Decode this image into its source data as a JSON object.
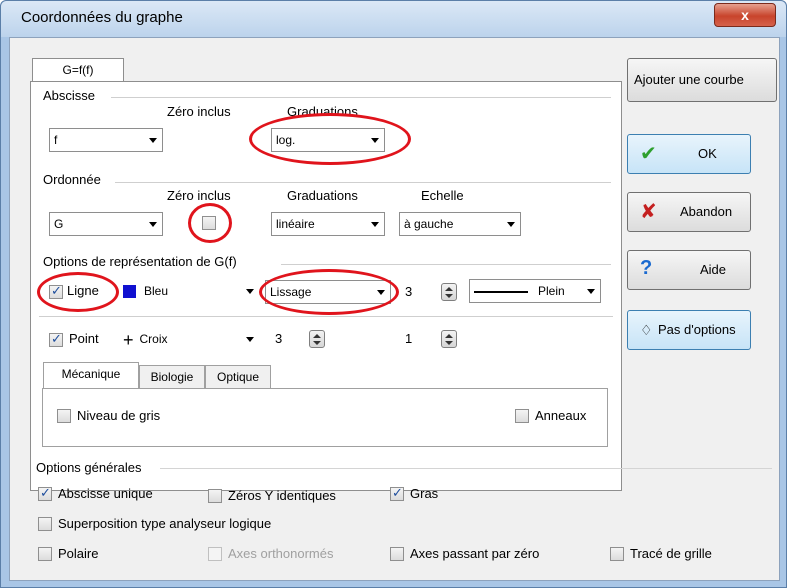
{
  "window": {
    "title": "Coordonnées du graphe",
    "close_label": "x"
  },
  "tab": {
    "label": "G=f(f)"
  },
  "abscisse": {
    "group_label": "Abscisse",
    "zero_label": "Zéro inclus",
    "grad_label": "Graduations",
    "variable": "f",
    "graduations": "log."
  },
  "ordonnee": {
    "group_label": "Ordonnée",
    "zero_label": "Zéro inclus",
    "grad_label": "Graduations",
    "echelle_label": "Echelle",
    "variable": "G",
    "zero_checked": false,
    "graduations": "linéaire",
    "echelle": "à gauche"
  },
  "representation": {
    "group_label": "Options de représentation de G(f)",
    "ligne_label": "Ligne",
    "ligne_checked": true,
    "color": "Bleu",
    "color_hex": "#1010d0",
    "lissage": "Lissage",
    "line_width": "3",
    "line_style": "Plein",
    "point_label": "Point",
    "point_checked": true,
    "point_type": "Croix",
    "point_size": "3",
    "point_value": "1"
  },
  "subtabs": {
    "items": [
      "Mécanique",
      "Biologie",
      "Optique"
    ],
    "niveau_gris": "Niveau de gris",
    "anneaux": "Anneaux"
  },
  "buttons": {
    "ajouter": "Ajouter une courbe",
    "ok": "OK",
    "abandon": "Abandon",
    "aide": "Aide",
    "pas_options": "Pas d'options"
  },
  "general": {
    "group_label": "Options générales",
    "abscisse_unique": "Abscisse unique",
    "abscisse_unique_checked": true,
    "zeros_y": "Zéros Y identiques",
    "zeros_y_checked": false,
    "gras": "Gras",
    "gras_checked": true,
    "superposition": "Superposition type analyseur logique",
    "polaire": "Polaire",
    "axes_ortho": "Axes orthonormés",
    "axes_zero": "Axes passant par zéro",
    "trace_grille": "Tracé de grille"
  }
}
